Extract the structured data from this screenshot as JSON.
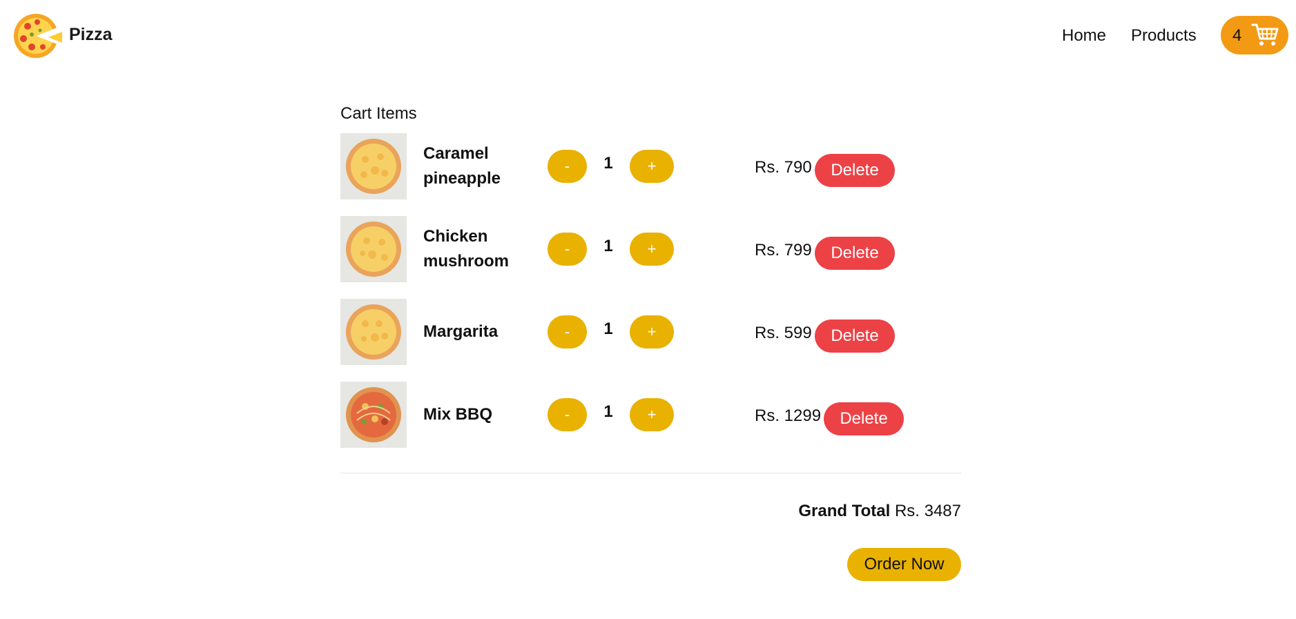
{
  "header": {
    "brand": "Pizza",
    "logo_icon": "pizza-icon",
    "nav": [
      {
        "label": "Home"
      },
      {
        "label": "Products"
      }
    ],
    "cart": {
      "count": "4",
      "icon": "cart-icon",
      "color": "#f39a14"
    }
  },
  "cart": {
    "title": "Cart Items",
    "items": [
      {
        "name": "Caramel pineapple",
        "quantity": "1",
        "price": "Rs. 790",
        "minus_label": "-",
        "plus_label": "+",
        "delete_label": "Delete",
        "thumb_icon": "pizza-thumbnail"
      },
      {
        "name": "Chicken mushroom",
        "quantity": "1",
        "price": "Rs. 799",
        "minus_label": "-",
        "plus_label": "+",
        "delete_label": "Delete",
        "thumb_icon": "pizza-thumbnail"
      },
      {
        "name": "Margarita",
        "quantity": "1",
        "price": "Rs. 599",
        "minus_label": "-",
        "plus_label": "+",
        "delete_label": "Delete",
        "thumb_icon": "pizza-thumbnail"
      },
      {
        "name": "Mix BBQ",
        "quantity": "1",
        "price": "Rs. 1299",
        "minus_label": "-",
        "plus_label": "+",
        "delete_label": "Delete",
        "thumb_icon": "pizza-thumbnail"
      }
    ],
    "grand_total_label": "Grand Total",
    "grand_total_value": "Rs. 3487",
    "order_label": "Order Now"
  },
  "colors": {
    "accent_yellow": "#e9b100",
    "delete_red": "#ec4246",
    "cart_orange": "#f39a14"
  }
}
